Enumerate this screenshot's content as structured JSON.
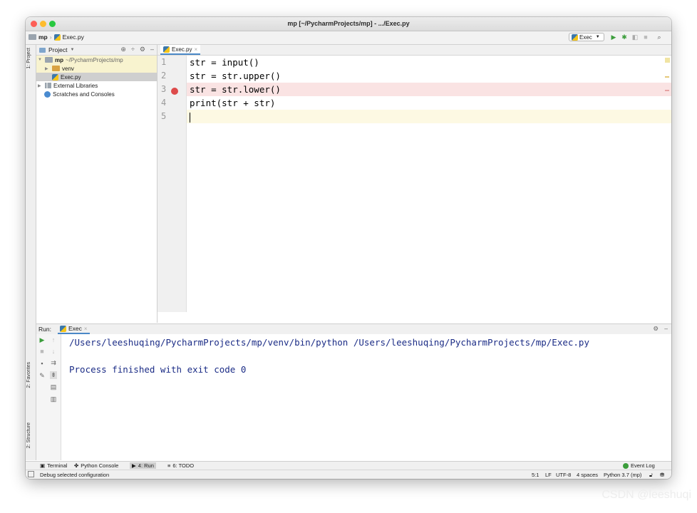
{
  "window": {
    "title": "mp [~/PycharmProjects/mp] - .../Exec.py"
  },
  "navbar": {
    "crumb_project": "mp",
    "crumb_file": "Exec.py",
    "run_config": "Exec"
  },
  "left_strip": {
    "project_tab": "1: Project",
    "favorites_tab": "2: Favorites",
    "structure_tab": "2: Structure"
  },
  "project_panel": {
    "title": "Project",
    "tree": {
      "root_name": "mp",
      "root_path": "~/PycharmProjects/mp",
      "venv": "venv",
      "file": "Exec.py",
      "external_libraries": "External Libraries",
      "scratches": "Scratches and Consoles"
    }
  },
  "editor": {
    "tab_label": "Exec.py",
    "line_numbers": [
      "1",
      "2",
      "3",
      "4",
      "5"
    ],
    "lines": [
      "str = input()",
      "str = str.upper()",
      "str = str.lower()",
      "print(str + str)",
      ""
    ],
    "breakpoint_line": 3,
    "current_line": 5
  },
  "run_panel": {
    "label": "Run:",
    "tab": "Exec",
    "console_command": "/Users/leeshuqing/PycharmProjects/mp/venv/bin/python /Users/leeshuqing/PycharmProjects/mp/Exec.py",
    "console_result": "Process finished with exit code 0"
  },
  "bottom_tabs": {
    "terminal": "Terminal",
    "python_console": "Python Console",
    "run": "4: Run",
    "todo": "6: TODO",
    "event_log": "Event Log"
  },
  "statusbar": {
    "message": "Debug selected configuration",
    "position": "5:1",
    "line_sep": "LF",
    "encoding": "UTF-8",
    "indent": "4 spaces",
    "interpreter": "Python 3.7 (mp)"
  },
  "watermark": "CSDN @leeshuqi",
  "colors": {
    "breakpoint": "#dd4b4b",
    "run_green": "#3b9d3b",
    "console_text": "#1b2c86"
  }
}
